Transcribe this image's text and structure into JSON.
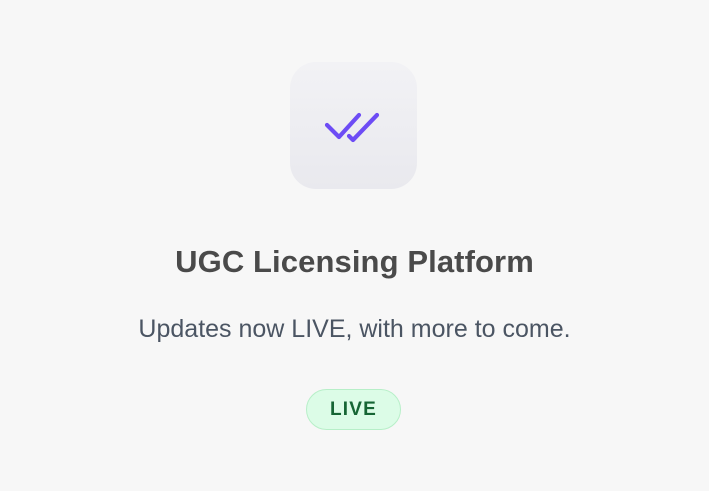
{
  "app": {
    "icon": "double-check-icon",
    "accent_color": "#6d4cf5"
  },
  "content": {
    "title": "UGC Licensing Platform",
    "subtitle": "Updates now LIVE, with more to come."
  },
  "status": {
    "label": "LIVE",
    "background_color": "#dcfce7",
    "text_color": "#166534"
  }
}
